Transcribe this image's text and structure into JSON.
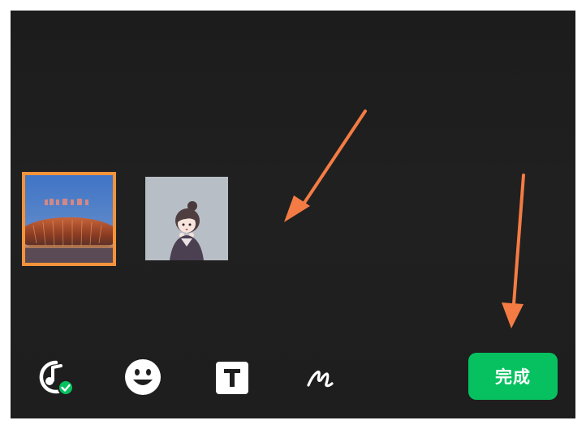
{
  "media_thumbnails": [
    {
      "icon": "stadium-night-photo",
      "selected": true
    },
    {
      "icon": "anime-girl-illustration",
      "selected": false
    }
  ],
  "toolbar": {
    "music_icon": "music-note-check-icon",
    "emoji_icon": "smiley-face-icon",
    "text_icon": "text-t-icon",
    "draw_icon": "pen-scribble-icon",
    "done_label": "完成"
  },
  "colors": {
    "accent_green": "#07c160",
    "highlight_orange": "#f3933b",
    "background": "#1e1e1e"
  }
}
